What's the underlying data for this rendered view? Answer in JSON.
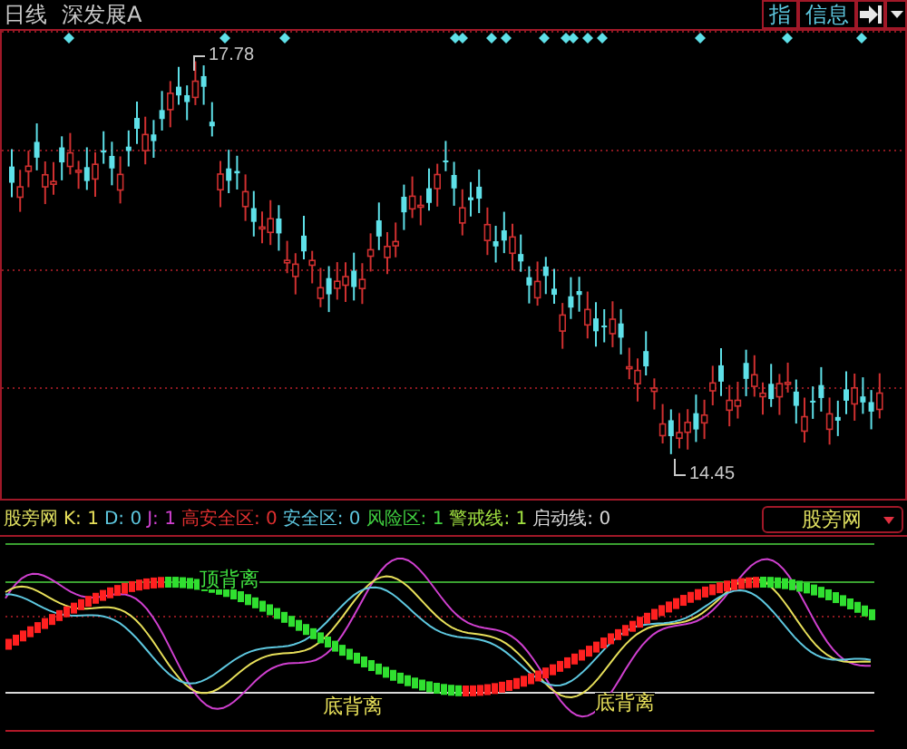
{
  "header": {
    "period": "日线",
    "stock_name": "深发展A",
    "buttons": [
      {
        "label": "指"
      },
      {
        "label": "信息"
      }
    ]
  },
  "main_chart": {
    "high_label": "17.78",
    "low_label": "14.45"
  },
  "indicator": {
    "name": "股旁网",
    "legend": [
      {
        "text": "K: 1",
        "color": "#e8e05a"
      },
      {
        "text": "D: 0",
        "color": "#5ec8e0"
      },
      {
        "text": "J: 1",
        "color": "#d040d0"
      },
      {
        "text": "高安全区: 0",
        "color": "#e03030"
      },
      {
        "text": "安全区: 0",
        "color": "#5ec8e0"
      },
      {
        "text": "风险区: 1",
        "color": "#40d040"
      },
      {
        "text": "警戒线: 1",
        "color": "#a0e040"
      },
      {
        "text": "启动线: 0",
        "color": "#d8d8d8"
      }
    ],
    "selector": "股旁网",
    "annotations": [
      {
        "text": "顶背离",
        "kind": "top"
      },
      {
        "text": "底背离",
        "kind": "bottom"
      },
      {
        "text": "底背离",
        "kind": "bottom"
      }
    ]
  }
}
